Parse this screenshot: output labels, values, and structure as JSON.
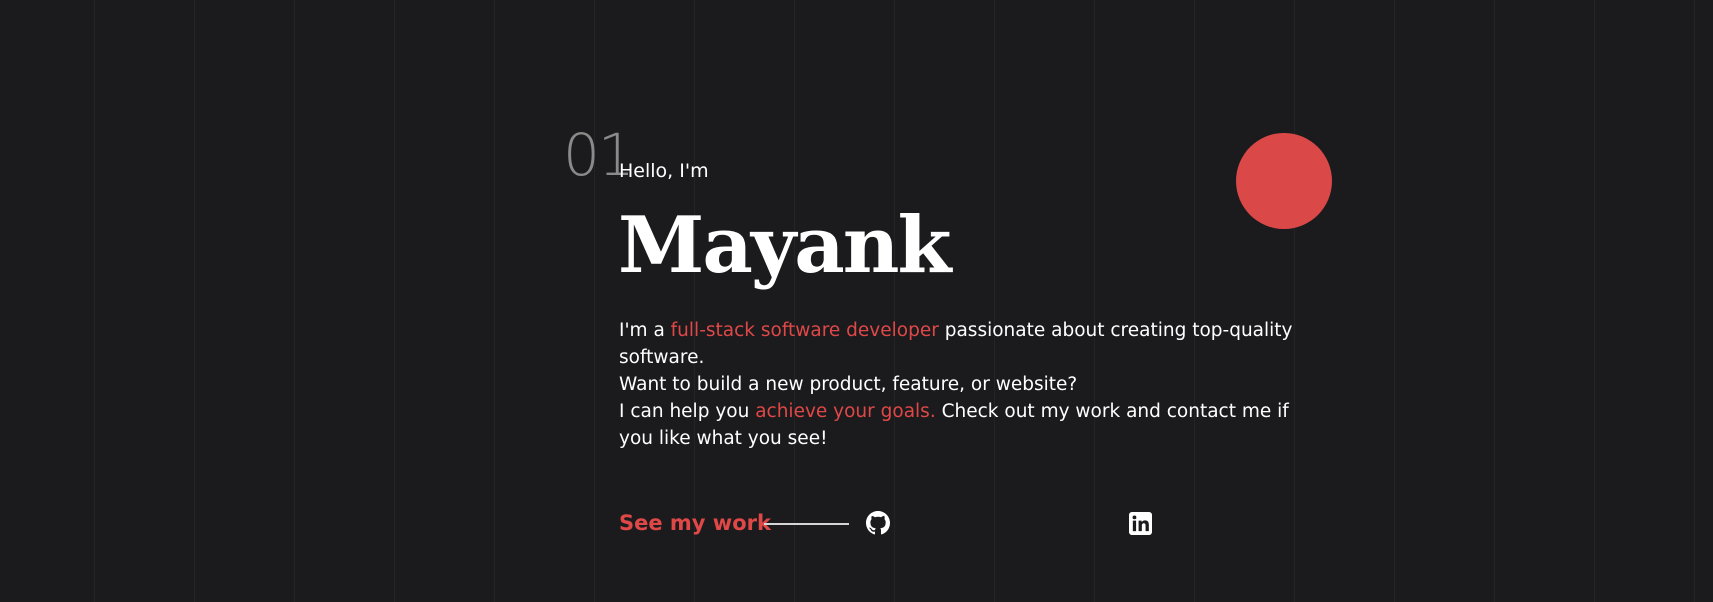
{
  "hero": {
    "section_number": "01",
    "greeting": "Hello, I'm",
    "name": "Mayank",
    "intro_lines": [
      {
        "prefix": "I'm a ",
        "highlight": "full-stack software developer",
        "suffix": " passionate about creating top-quality software."
      },
      {
        "text": "Want to build a new product, feature, or website?"
      },
      {
        "prefix": "I can help you ",
        "highlight": "achieve your goals.",
        "suffix": " Check out my work and contact me if you like what you see!"
      }
    ]
  },
  "cta": {
    "see_work_label": "See my work"
  },
  "social": {
    "github_icon": "github-icon",
    "linkedin_icon": "linkedin-icon"
  },
  "colors": {
    "background": "#1b1b1d",
    "accent": "#e04848",
    "circle": "#db4848",
    "text": "#ffffff"
  }
}
